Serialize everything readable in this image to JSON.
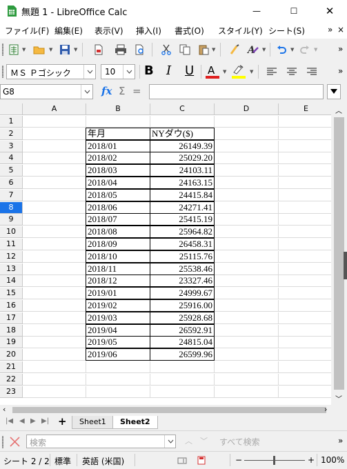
{
  "window": {
    "title": "無題 1 - LibreOffice Calc",
    "minimize_glyph": "—",
    "maximize_glyph": "☐",
    "close_glyph": "✕"
  },
  "menu": {
    "items": [
      "ファイル(F)",
      "編集(E)",
      "表示(V)",
      "挿入(I)",
      "書式(O)",
      "スタイル(Y)",
      "シート(S)"
    ],
    "overflow": "»",
    "close": "×"
  },
  "toolbar": {
    "overflow": "»",
    "font_name": "ＭＳ Ｐゴシック",
    "font_size": "10",
    "bold": "B",
    "italic": "I",
    "underline": "U",
    "font_color_letter": "A",
    "colors": {
      "font_color": "#e02020",
      "highlight": "#ffff00",
      "accent": "#1a73e8"
    }
  },
  "formula_bar": {
    "cell_ref": "G8",
    "fx": "fx",
    "sum": "Σ",
    "equals": "=",
    "content": ""
  },
  "grid": {
    "columns": [
      "A",
      "B",
      "C",
      "D",
      "E"
    ],
    "rows": [
      "1",
      "2",
      "3",
      "4",
      "5",
      "6",
      "7",
      "8",
      "9",
      "10",
      "11",
      "12",
      "13",
      "14",
      "15",
      "16",
      "17",
      "18",
      "19",
      "20",
      "21",
      "22",
      "23"
    ],
    "active_row": "8",
    "header": {
      "b": "年月",
      "c": "NYダウ($)"
    },
    "data": [
      {
        "b": "2018/01",
        "c": "26149.39"
      },
      {
        "b": "2018/02",
        "c": "25029.20"
      },
      {
        "b": "2018/03",
        "c": "24103.11"
      },
      {
        "b": "2018/04",
        "c": "24163.15"
      },
      {
        "b": "2018/05",
        "c": "24415.84"
      },
      {
        "b": "2018/06",
        "c": "24271.41"
      },
      {
        "b": "2018/07",
        "c": "25415.19"
      },
      {
        "b": "2018/08",
        "c": "25964.82"
      },
      {
        "b": "2018/09",
        "c": "26458.31"
      },
      {
        "b": "2018/10",
        "c": "25115.76"
      },
      {
        "b": "2018/11",
        "c": "25538.46"
      },
      {
        "b": "2018/12",
        "c": "23327.46"
      },
      {
        "b": "2019/01",
        "c": "24999.67"
      },
      {
        "b": "2019/02",
        "c": "25916.00"
      },
      {
        "b": "2019/03",
        "c": "25928.68"
      },
      {
        "b": "2019/04",
        "c": "26592.91"
      },
      {
        "b": "2019/05",
        "c": "24815.04"
      },
      {
        "b": "2019/06",
        "c": "26599.96"
      }
    ]
  },
  "sheets": {
    "add": "+",
    "tabs": [
      "Sheet1",
      "Sheet2"
    ],
    "active": "Sheet2"
  },
  "find": {
    "placeholder": "検索",
    "find_all": "すべて検索",
    "overflow": "»"
  },
  "status": {
    "sheet": "シート 2 / 2",
    "style": "標準",
    "language": "英語 (米国)",
    "zoom": "100%",
    "zoom_minus": "−",
    "zoom_plus": "+"
  }
}
